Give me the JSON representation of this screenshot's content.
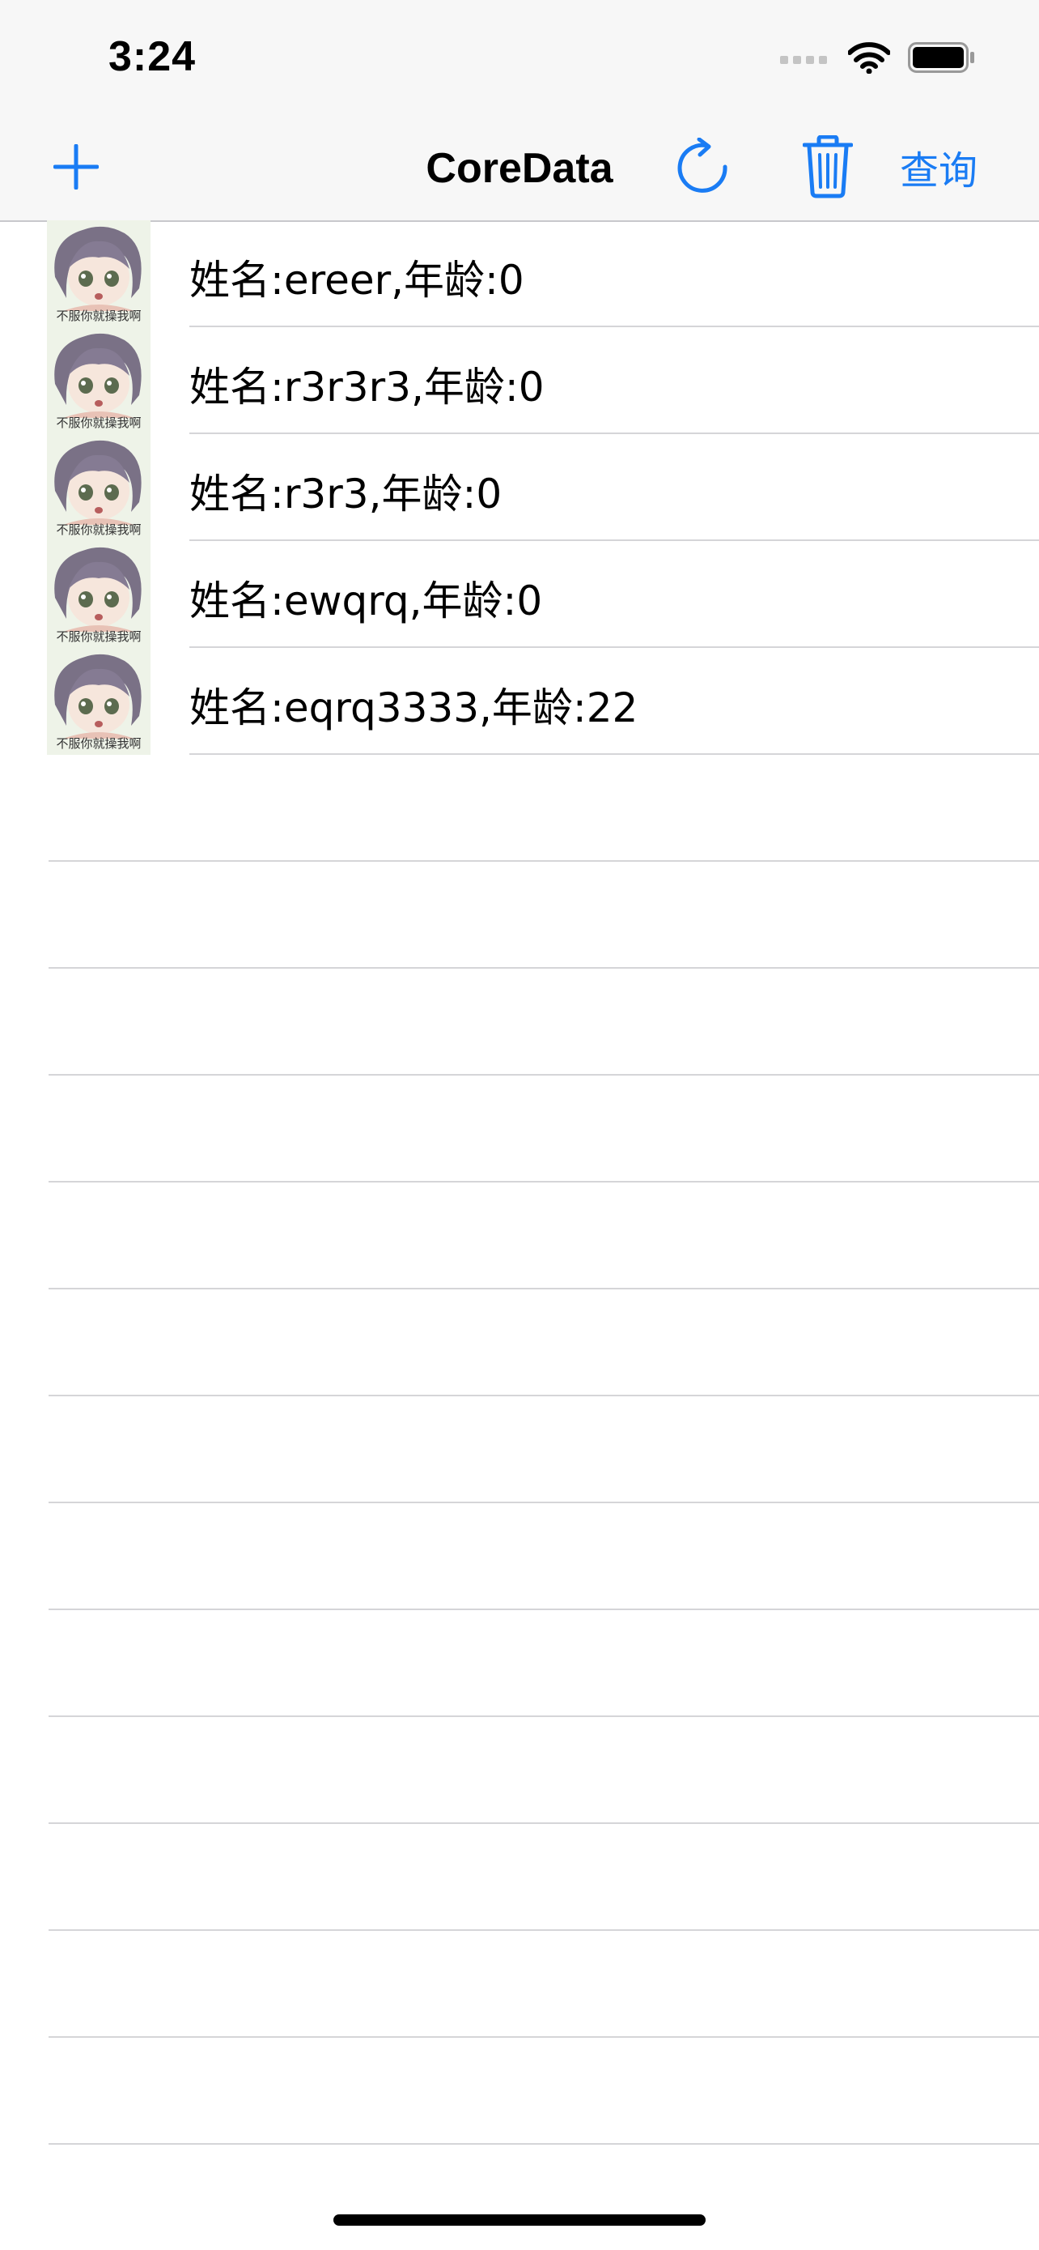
{
  "status_bar": {
    "time": "3:24"
  },
  "nav": {
    "title": "CoreData",
    "query_label": "查询",
    "icons": [
      "plus-icon",
      "refresh-icon",
      "trash-icon"
    ],
    "accent_color": "#1a7cf4"
  },
  "rows": [
    {
      "label": "姓名:ereer,年龄:0",
      "thumb_caption": "不服你就操我啊"
    },
    {
      "label": "姓名:r3r3r3,年龄:0",
      "thumb_caption": "不服你就操我啊"
    },
    {
      "label": "姓名:r3r3,年龄:0",
      "thumb_caption": "不服你就操我啊"
    },
    {
      "label": "姓名:ewqrq,年龄:0",
      "thumb_caption": "不服你就操我啊"
    },
    {
      "label": "姓名:eqrq3333,年龄:22",
      "thumb_caption": "不服你就操我啊"
    }
  ]
}
